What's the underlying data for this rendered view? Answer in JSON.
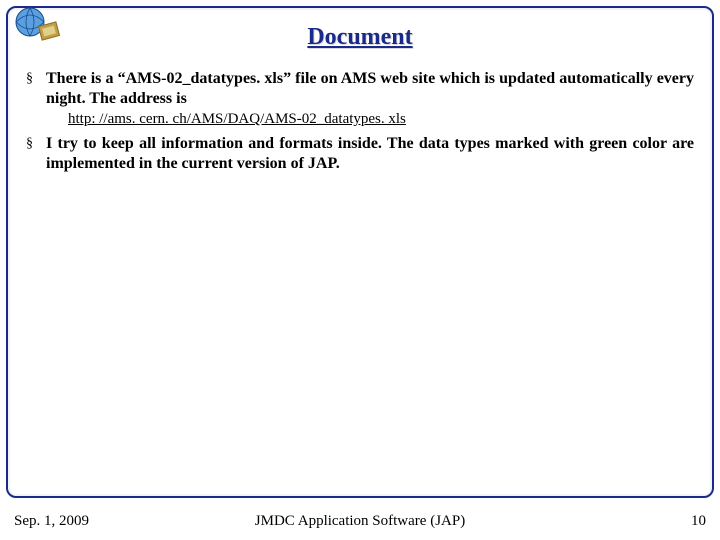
{
  "title": "Document",
  "bullets": [
    {
      "text": "There is a “AMS-02_datatypes. xls” file on AMS web site which is updated automatically every night. The address is",
      "link": "http: //ams. cern. ch/AMS/DAQ/AMS-02_datatypes. xls"
    },
    {
      "text": "I try to keep all information and formats inside. The data types marked with green color are implemented in the current version of JAP.",
      "link": null
    }
  ],
  "footer": {
    "left": "Sep. 1, 2009",
    "center": "JMDC Application Software (JAP)",
    "right": "10"
  },
  "logo": {
    "name": "ams-globe-icon"
  }
}
